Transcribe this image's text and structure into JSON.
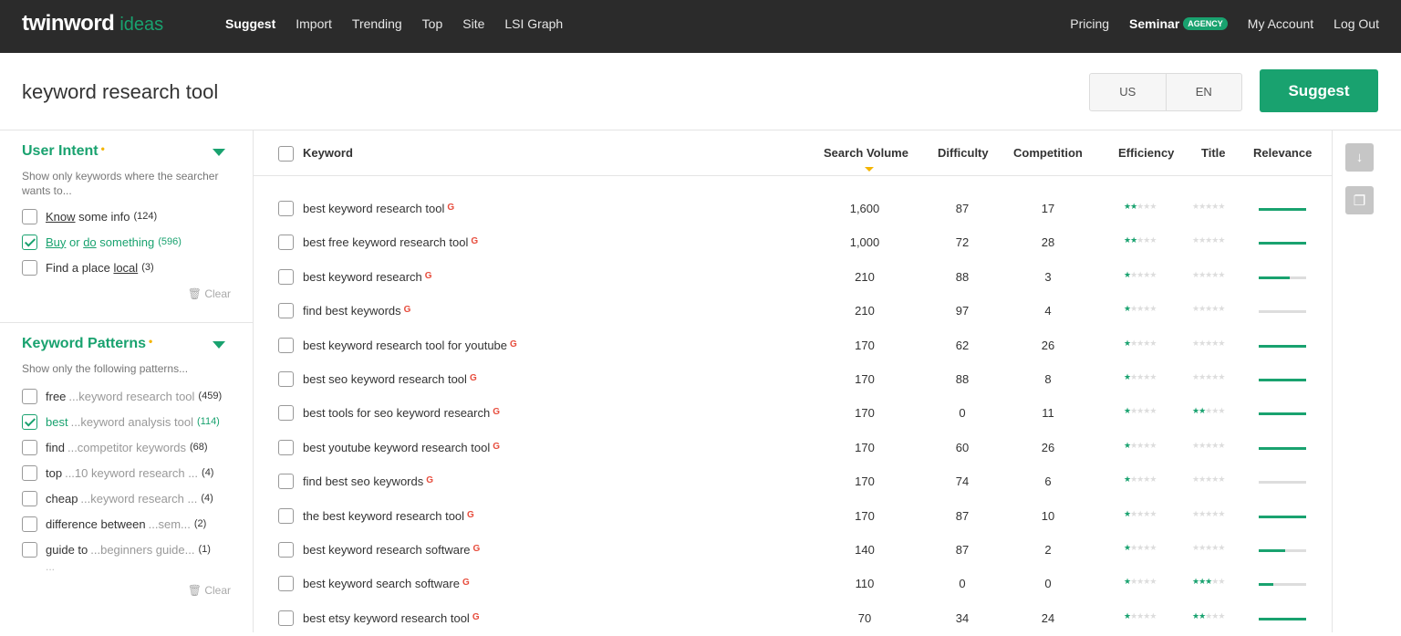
{
  "nav": {
    "logo": "twinword",
    "logo_sub": "ideas",
    "items": [
      "Suggest",
      "Import",
      "Trending",
      "Top",
      "Site",
      "LSI Graph"
    ],
    "right": {
      "pricing": "Pricing",
      "seminar": "Seminar",
      "agency_badge": "AGENCY",
      "account": "My Account",
      "logout": "Log Out"
    }
  },
  "search": {
    "query": "keyword research tool",
    "country": "US",
    "language": "EN",
    "button": "Suggest"
  },
  "sidebar": {
    "intent": {
      "title": "User Intent",
      "desc": "Show only keywords where the searcher wants to...",
      "options": [
        {
          "pre": "",
          "u1": "Know",
          "mid": " some info",
          "u2": "",
          "post": "",
          "count": "(124)",
          "checked": false
        },
        {
          "pre": "",
          "u1": "Buy",
          "mid": " or ",
          "u2": "do",
          "post": " something",
          "count": "(596)",
          "checked": true
        },
        {
          "pre": "Find a place ",
          "u1": "local",
          "mid": "",
          "u2": "",
          "post": "",
          "count": "(3)",
          "checked": false
        }
      ],
      "clear": "Clear"
    },
    "patterns": {
      "title": "Keyword Patterns",
      "desc": "Show only the following patterns...",
      "options": [
        {
          "word": "free",
          "rest": "...keyword research tool",
          "count": "(459)",
          "checked": false
        },
        {
          "word": "best",
          "rest": "...keyword analysis tool",
          "count": "(114)",
          "checked": true
        },
        {
          "word": "find",
          "rest": "...competitor keywords",
          "count": "(68)",
          "checked": false
        },
        {
          "word": "top",
          "rest": "...10 keyword research ...",
          "count": "(4)",
          "checked": false
        },
        {
          "word": "cheap",
          "rest": "...keyword research ...",
          "count": "(4)",
          "checked": false
        },
        {
          "word": "difference between",
          "rest": "...sem...",
          "count": "(2)",
          "checked": false
        },
        {
          "word": "guide to",
          "rest": "...beginners guide...",
          "count": "(1)",
          "checked": false
        }
      ],
      "more": "...",
      "clear": "Clear"
    }
  },
  "table": {
    "headers": {
      "keyword": "Keyword",
      "volume": "Search Volume",
      "difficulty": "Difficulty",
      "competition": "Competition",
      "efficiency": "Efficiency",
      "title": "Title",
      "relevance": "Relevance"
    },
    "rows": [
      {
        "keyword": "best keyword research tool",
        "volume": "1,600",
        "difficulty": "87",
        "competition": "17",
        "efficiency": 2,
        "title": 0,
        "relevance": 1.0
      },
      {
        "keyword": "best free keyword research tool",
        "volume": "1,000",
        "difficulty": "72",
        "competition": "28",
        "efficiency": 2,
        "title": 0,
        "relevance": 1.0
      },
      {
        "keyword": "best keyword research",
        "volume": "210",
        "difficulty": "88",
        "competition": "3",
        "efficiency": 1,
        "title": 0,
        "relevance": 0.65
      },
      {
        "keyword": "find best keywords",
        "volume": "210",
        "difficulty": "97",
        "competition": "4",
        "efficiency": 1,
        "title": 0,
        "relevance": 0.0
      },
      {
        "keyword": "best keyword research tool for youtube",
        "volume": "170",
        "difficulty": "62",
        "competition": "26",
        "efficiency": 1,
        "title": 0,
        "relevance": 1.0
      },
      {
        "keyword": "best seo keyword research tool",
        "volume": "170",
        "difficulty": "88",
        "competition": "8",
        "efficiency": 1,
        "title": 0,
        "relevance": 1.0
      },
      {
        "keyword": "best tools for seo keyword research",
        "volume": "170",
        "difficulty": "0",
        "competition": "11",
        "efficiency": 1,
        "title": 2,
        "relevance": 1.0
      },
      {
        "keyword": "best youtube keyword research tool",
        "volume": "170",
        "difficulty": "60",
        "competition": "26",
        "efficiency": 1,
        "title": 0,
        "relevance": 1.0
      },
      {
        "keyword": "find best seo keywords",
        "volume": "170",
        "difficulty": "74",
        "competition": "6",
        "efficiency": 1,
        "title": 0,
        "relevance": 0.0
      },
      {
        "keyword": "the best keyword research tool",
        "volume": "170",
        "difficulty": "87",
        "competition": "10",
        "efficiency": 1,
        "title": 0,
        "relevance": 1.0
      },
      {
        "keyword": "best keyword research software",
        "volume": "140",
        "difficulty": "87",
        "competition": "2",
        "efficiency": 1,
        "title": 0,
        "relevance": 0.55
      },
      {
        "keyword": "best keyword search software",
        "volume": "110",
        "difficulty": "0",
        "competition": "0",
        "efficiency": 1,
        "title": 3,
        "relevance": 0.3
      },
      {
        "keyword": "best etsy keyword research tool",
        "volume": "70",
        "difficulty": "34",
        "competition": "24",
        "efficiency": 1,
        "title": 2,
        "relevance": 1.0
      }
    ],
    "google_mark": "G"
  },
  "tools": [
    {
      "icon": "download-icon",
      "glyph": "↓"
    },
    {
      "icon": "copy-icon",
      "glyph": "❐"
    }
  ],
  "colors": {
    "accent": "#19a26f",
    "header_bg": "#2b2b2b",
    "required_dot": "#f4b400"
  }
}
